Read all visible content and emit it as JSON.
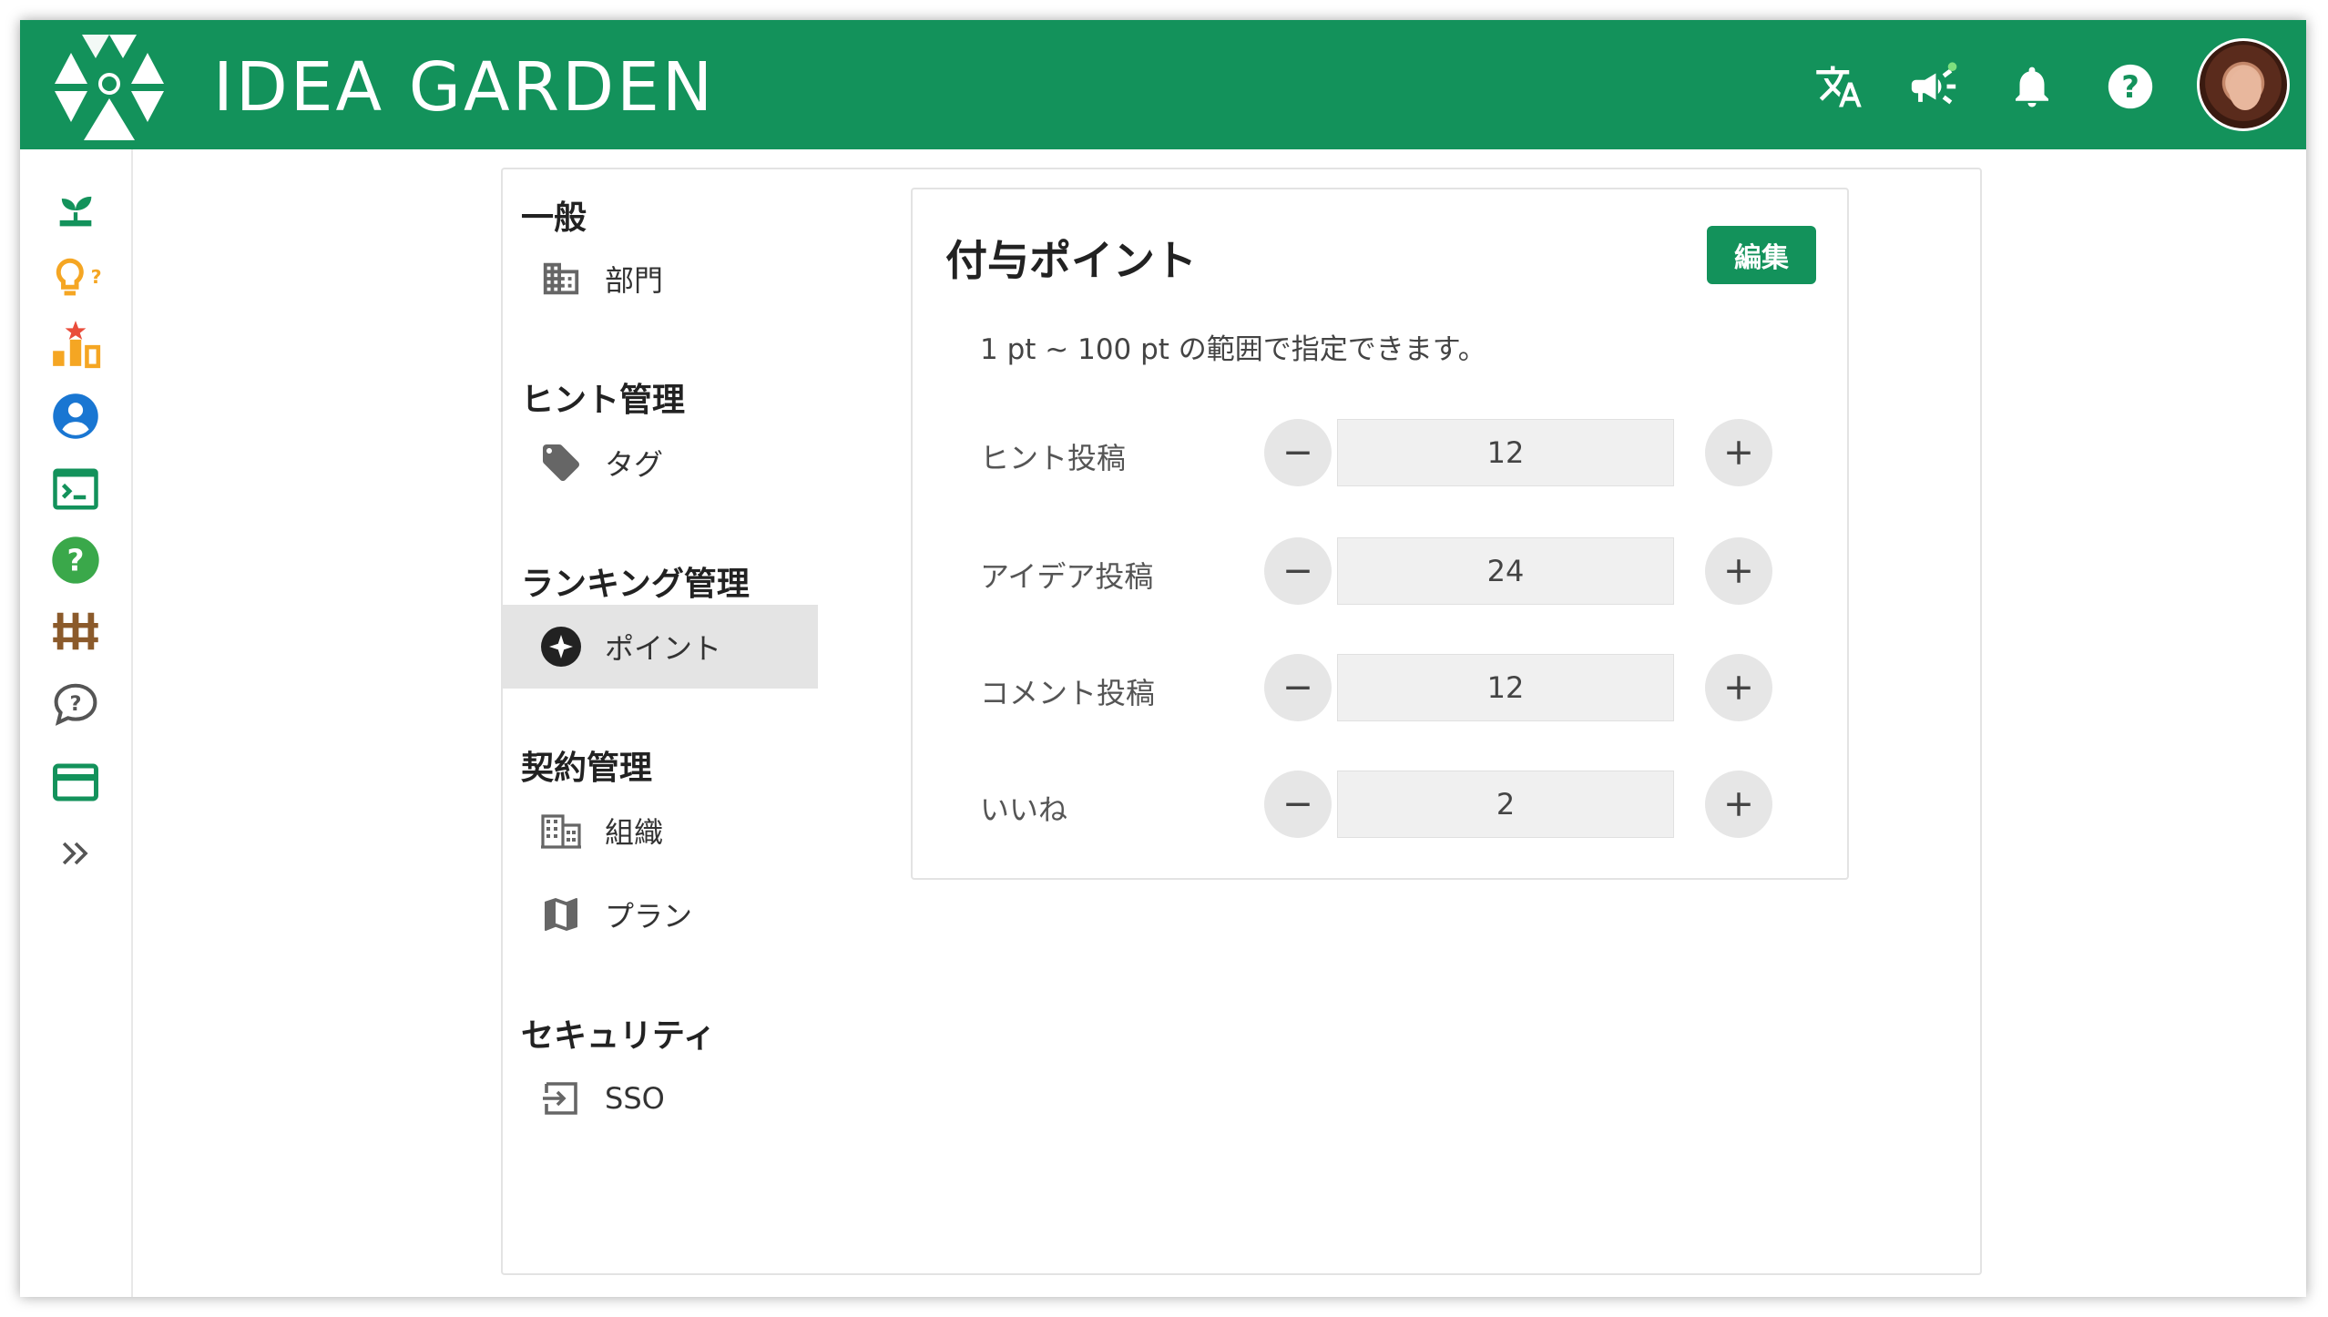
{
  "header": {
    "brand": "IDEA GARDEN",
    "icons": [
      "translate-icon",
      "announcement-icon",
      "bell-icon",
      "help-icon",
      "avatar"
    ]
  },
  "sidebar": {
    "icons": [
      "sprout-icon",
      "lightbulb-question-icon",
      "ranking-icon",
      "account-icon",
      "terminal-icon",
      "help-circle-icon",
      "fence-icon",
      "chat-question-icon",
      "card-icon",
      "expand-icon"
    ]
  },
  "menu": {
    "sections": [
      {
        "title": "一般",
        "items": [
          {
            "label": "部門",
            "icon": "building-icon"
          }
        ]
      },
      {
        "title": "ヒント管理",
        "items": [
          {
            "label": "タグ",
            "icon": "tag-icon"
          }
        ]
      },
      {
        "title": "ランキング管理",
        "items": [
          {
            "label": "ポイント",
            "icon": "point-icon",
            "active": true
          }
        ]
      },
      {
        "title": "契約管理",
        "items": [
          {
            "label": "組織",
            "icon": "office-icon"
          },
          {
            "label": "プラン",
            "icon": "map-icon"
          }
        ]
      },
      {
        "title": "セキュリティ",
        "items": [
          {
            "label": "SSO",
            "icon": "login-icon"
          }
        ]
      }
    ]
  },
  "card": {
    "title": "付与ポイント",
    "edit_label": "編集",
    "hint": "1 pt ~ 100 pt の範囲で指定できます。",
    "rows": [
      {
        "label": "ヒント投稿",
        "value": "12"
      },
      {
        "label": "アイデア投稿",
        "value": "24"
      },
      {
        "label": "コメント投稿",
        "value": "12"
      },
      {
        "label": "いいね",
        "value": "2"
      }
    ]
  },
  "colors": {
    "brand": "#13925b",
    "active_bg": "#e4e4e4"
  }
}
